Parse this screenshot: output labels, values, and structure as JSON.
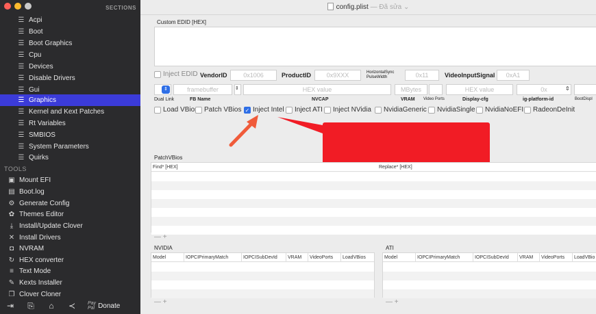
{
  "sidebar": {
    "section_header": "SECTIONS",
    "items": [
      {
        "label": "Acpi",
        "icon": "list-icon"
      },
      {
        "label": "Boot",
        "icon": "list-icon"
      },
      {
        "label": "Boot Graphics",
        "icon": "list-icon"
      },
      {
        "label": "Cpu",
        "icon": "list-icon"
      },
      {
        "label": "Devices",
        "icon": "list-icon"
      },
      {
        "label": "Disable Drivers",
        "icon": "list-icon"
      },
      {
        "label": "Gui",
        "icon": "list-icon"
      },
      {
        "label": "Graphics",
        "icon": "list-icon",
        "selected": true
      },
      {
        "label": "Kernel and Kext Patches",
        "icon": "list-icon"
      },
      {
        "label": "Rt Variables",
        "icon": "list-icon"
      },
      {
        "label": "SMBIOS",
        "icon": "list-icon"
      },
      {
        "label": "System Parameters",
        "icon": "list-icon"
      },
      {
        "label": "Quirks",
        "icon": "list-icon"
      }
    ],
    "tools_header": "TOOLS",
    "tools": [
      {
        "label": "Mount EFI",
        "icon": "disk-icon"
      },
      {
        "label": "Boot.log",
        "icon": "log-icon"
      },
      {
        "label": "Generate Config",
        "icon": "gear-icon"
      },
      {
        "label": "Themes Editor",
        "icon": "palette-icon"
      },
      {
        "label": "Install/Update Clover",
        "icon": "download-icon"
      },
      {
        "label": "Install Drivers",
        "icon": "tools-icon"
      },
      {
        "label": "NVRAM",
        "icon": "chip-icon"
      },
      {
        "label": "HEX converter",
        "icon": "refresh-icon"
      },
      {
        "label": "Text Mode",
        "icon": "text-icon"
      },
      {
        "label": "Kexts Installer",
        "icon": "wrench-icon"
      },
      {
        "label": "Clover Cloner",
        "icon": "copy-icon"
      }
    ],
    "bottom": {
      "paypal_top": "Pay",
      "paypal_bottom": "Pal",
      "donate": "Donate"
    }
  },
  "window": {
    "title": "config.plist",
    "subtitle": "— Đã sửa ⌄"
  },
  "graphics": {
    "custom_edid_label": "Custom EDID [HEX]",
    "inject_edid": "Inject EDID",
    "vendor_id_label": "VendorID",
    "vendor_id_placeholder": "0x1006",
    "product_id_label": "ProductID",
    "product_id_placeholder": "0x9XXX",
    "hsync_top": "HorizontalSync",
    "hsync_bottom": "PulseWidth",
    "hsync_placeholder": "0x11",
    "video_input_label": "VideoInputSignal",
    "video_input_placeholder": "0xA1",
    "framebuffer_placeholder": "framebuffer",
    "hex_value_placeholder": "HEX value",
    "mbytes_placeholder": "MBytes",
    "hex_value2_placeholder": "HEX value",
    "ox_placeholder": "0x",
    "labels": {
      "dual_link": "Dual Link",
      "fb_name": "FB Name",
      "nvcap": "NVCAP",
      "vram": "VRAM",
      "video_ports": "Video Ports",
      "display_cfg": "Display-cfg",
      "ig_platform_id": "ig-platform-id",
      "boot_displ": "BootDispl"
    },
    "checks": [
      {
        "label": "Load VBios",
        "checked": false
      },
      {
        "label": "Patch VBios",
        "checked": false
      },
      {
        "label": "Inject Intel",
        "checked": true
      },
      {
        "label": "Inject ATI",
        "checked": false
      },
      {
        "label": "Inject NVidia",
        "checked": false
      },
      {
        "label": "NvidiaGeneric",
        "checked": false
      },
      {
        "label": "NvidiaSingle",
        "checked": false
      },
      {
        "label": "NvidiaNoEFI",
        "checked": false
      },
      {
        "label": "RadeonDeInit",
        "checked": false
      }
    ],
    "patch_vbios": {
      "title": "PatchVBios",
      "find": "Find* [HEX]",
      "replace": "Replace* [HEX]",
      "add_remove": "— +"
    },
    "nvidia": {
      "title": "NVIDIA",
      "columns": [
        "Model",
        "IOPCIPrimaryMatch",
        "IOPCISubDevId",
        "VRAM",
        "VideoPorts",
        "LoadVBios"
      ],
      "add_remove": "— +"
    },
    "ati": {
      "title": "ATI",
      "columns": [
        "Model",
        "IOPCIPrimaryMatch",
        "IOPCISubDevId",
        "VRAM",
        "VideoPorts",
        "LoadVBio"
      ],
      "add_remove": "— +"
    }
  },
  "colors": {
    "accent": "#3b3bd9",
    "annotation_red": "#f11c25"
  }
}
